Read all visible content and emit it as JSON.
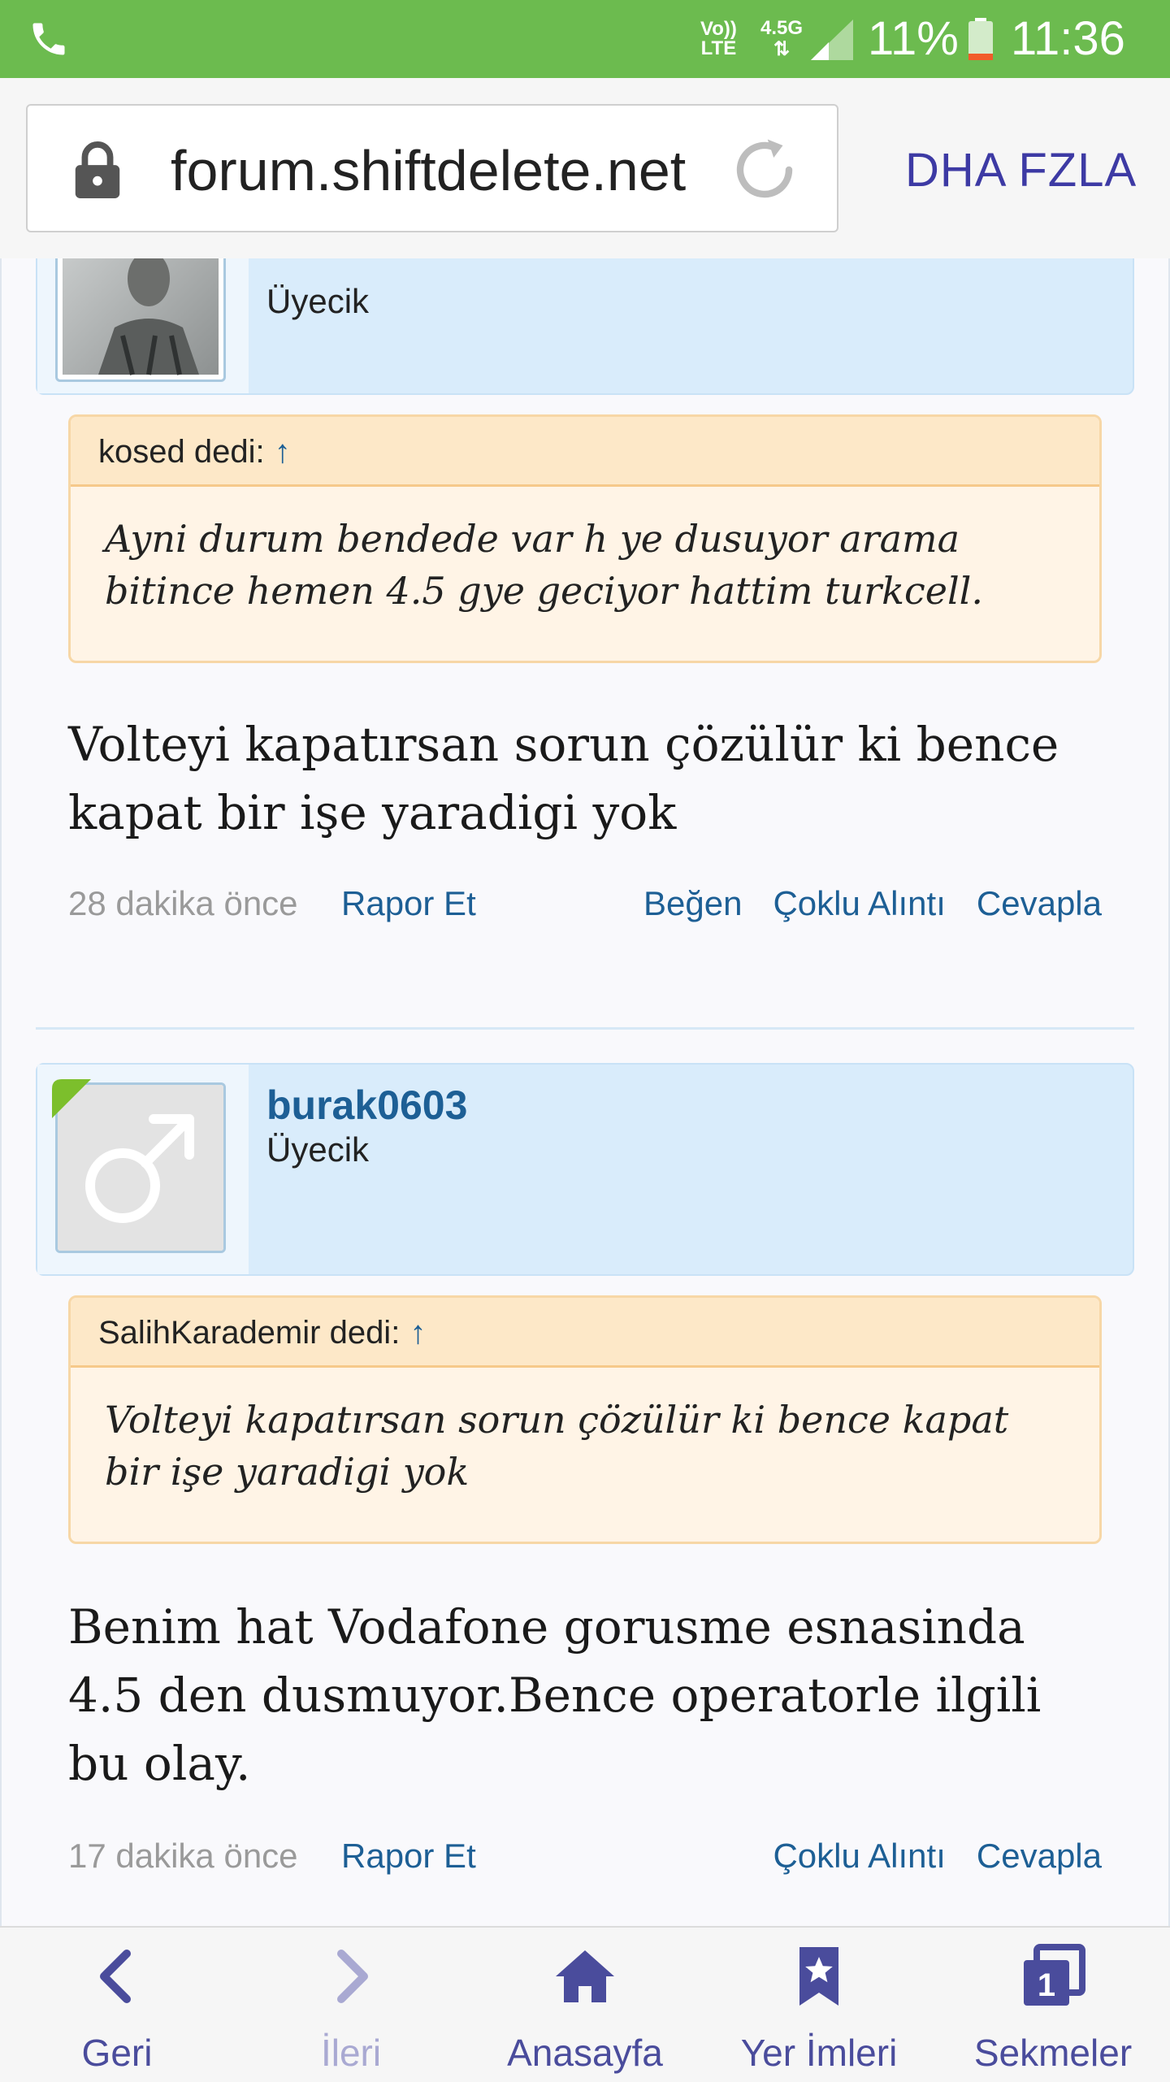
{
  "status_bar": {
    "network_lines": [
      "Vo))",
      "LTE"
    ],
    "network_gen_lines": [
      "4.5G",
      "⇅"
    ],
    "battery_percent": "11%",
    "time": "11:36"
  },
  "browser": {
    "url": "forum.shiftdelete.net",
    "more_label": "DHA FZLA"
  },
  "posts": [
    {
      "username": "",
      "user_title": "Üyecik",
      "quote_author": "kosed dedi:",
      "quote_arrow": "↑",
      "quote_text": "Ayni durum bendede var h ye dusuyor arama bitince hemen 4.5 gye geciyor hattim turkcell.",
      "text": "Volteyi kapatırsan sorun çözülür ki bence kapat bir işe yaradigi yok",
      "time": "28 dakika önce",
      "report": "Rapor Et",
      "actions": [
        "Beğen",
        "Çoklu Alıntı",
        "Cevapla"
      ]
    },
    {
      "username": "burak0603",
      "user_title": "Üyecik",
      "quote_author": "SalihKarademir dedi:",
      "quote_arrow": "↑",
      "quote_text": "Volteyi kapatırsan sorun çözülür ki bence kapat bir işe yaradigi yok",
      "text": "Benim hat Vodafone gorusme esnasinda 4.5 den dusmuyor.Bence operatorle ilgili bu olay.",
      "time": "17 dakika önce",
      "report": "Rapor Et",
      "actions": [
        "Çoklu Alıntı",
        "Cevapla"
      ]
    }
  ],
  "bottom_nav": [
    {
      "label": "Geri",
      "icon": "back-arrow-icon"
    },
    {
      "label": "İleri",
      "icon": "forward-arrow-icon"
    },
    {
      "label": "Anasayfa",
      "icon": "home-icon"
    },
    {
      "label": "Yer İmleri",
      "icon": "bookmark-icon"
    },
    {
      "label": "Sekmeler",
      "icon": "tabs-icon",
      "badge": "1"
    }
  ],
  "colors": {
    "status_bar": "#6cbb4f",
    "link": "#1d5f95",
    "nav": "#4a4c9c",
    "quote_bg": "#fff4e6",
    "userbar_bg": "#d9ecfb"
  }
}
